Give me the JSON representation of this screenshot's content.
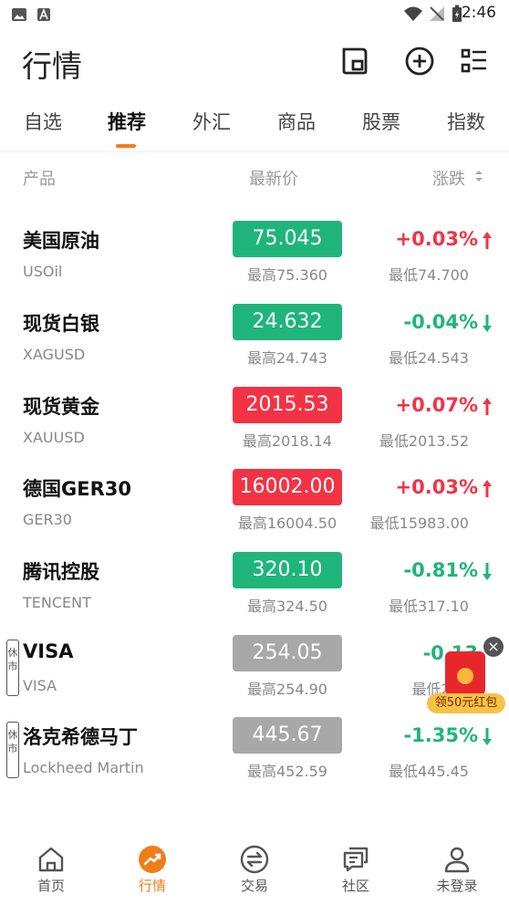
{
  "status": {
    "time": "2:46"
  },
  "header": {
    "title": "行情"
  },
  "tabs": [
    {
      "label": "自选"
    },
    {
      "label": "推荐"
    },
    {
      "label": "外汇"
    },
    {
      "label": "商品"
    },
    {
      "label": "股票"
    },
    {
      "label": "指数"
    }
  ],
  "columns": {
    "product": "产品",
    "latest": "最新价",
    "change": "涨跌"
  },
  "rows": [
    {
      "name": "美国原油",
      "code": "USOil",
      "price": "75.045",
      "high": "最高75.360",
      "change": "+0.03%",
      "low": "最低74.700",
      "dir": "up",
      "box": "down"
    },
    {
      "name": "现货白银",
      "code": "XAGUSD",
      "price": "24.632",
      "high": "最高24.743",
      "change": "-0.04%",
      "low": "最低24.543",
      "dir": "down",
      "box": "down"
    },
    {
      "name": "现货黄金",
      "code": "XAUUSD",
      "price": "2015.53",
      "high": "最高2018.14",
      "change": "+0.07%",
      "low": "最低2013.52",
      "dir": "up",
      "box": "up"
    },
    {
      "name": "德国GER30",
      "code": "GER30",
      "price": "16002.00",
      "high": "最高16004.50",
      "change": "+0.03%",
      "low": "最低15983.00",
      "dir": "up",
      "box": "up"
    },
    {
      "name": "腾讯控股",
      "code": "TENCENT",
      "price": "320.10",
      "high": "最高324.50",
      "change": "-0.81%",
      "low": "最低317.10",
      "dir": "down",
      "box": "down"
    },
    {
      "name": "VISA",
      "code": "VISA",
      "price": "254.05",
      "high": "最高254.90",
      "change": "-0.13",
      "low": "最低252",
      "dir": "down",
      "box": "closed",
      "tag": "休市"
    },
    {
      "name": "洛克希德马丁",
      "code": "Lockheed Martin",
      "price": "445.67",
      "high": "最高452.59",
      "change": "-1.35%",
      "low": "最低445.45",
      "dir": "down",
      "box": "closed",
      "tag": "休市"
    }
  ],
  "promo": {
    "label": "领50元红包",
    "close": "×"
  },
  "nav": [
    {
      "label": "首页",
      "icon": "home-icon"
    },
    {
      "label": "行情",
      "icon": "trend-icon"
    },
    {
      "label": "交易",
      "icon": "exchange-icon"
    },
    {
      "label": "社区",
      "icon": "chat-icon"
    },
    {
      "label": "未登录",
      "icon": "user-icon"
    }
  ],
  "colors": {
    "accent": "#f07d19",
    "up": "#f23345",
    "down": "#1fb57a",
    "closed": "#a8a8a8"
  }
}
